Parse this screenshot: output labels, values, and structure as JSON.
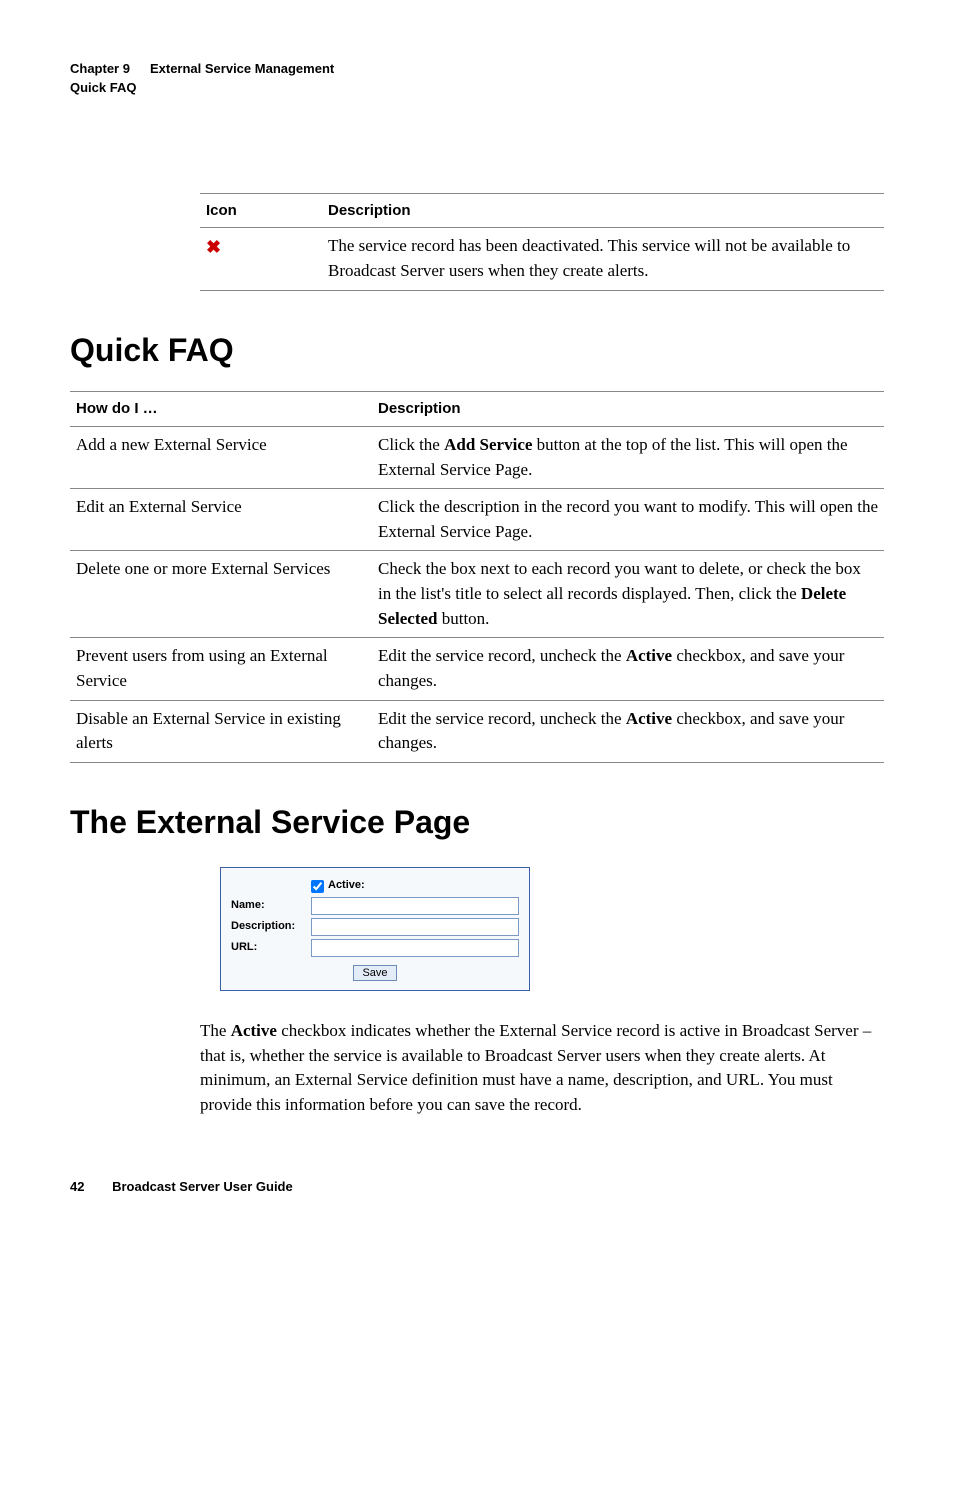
{
  "header": {
    "chapter_label": "Chapter 9",
    "chapter_title": "External Service Management",
    "section_label": "Quick FAQ"
  },
  "icon_table": {
    "head_icon": "Icon",
    "head_desc": "Description",
    "rows": [
      {
        "icon_name": "x-icon",
        "desc": "The service record has been deactivated. This service will not be available to Broadcast Server users when they create alerts."
      }
    ]
  },
  "section1": {
    "title": "Quick FAQ"
  },
  "faq_table": {
    "head_howdo": "How do I …",
    "head_desc": "Description",
    "rows": [
      {
        "howdo": "Add a new External Service",
        "desc_pre": "Click the ",
        "desc_bold": "Add Service",
        "desc_post": " button at the top of the list. This will open the External Service Page."
      },
      {
        "howdo": "Edit an External Service",
        "desc_plain": "Click the description in the record you want to modify. This will open the External Service Page."
      },
      {
        "howdo": "Delete one or more External Services",
        "desc_pre": "Check the box next to each record you want to delete, or check the box in the list's title to select all records displayed. Then, click the ",
        "desc_bold": "Delete Selected",
        "desc_post": " button."
      },
      {
        "howdo": "Prevent users from using an External Service",
        "desc_pre": "Edit the service record, uncheck the ",
        "desc_bold": "Active",
        "desc_post": " checkbox, and save your changes."
      },
      {
        "howdo": "Disable an External Service in existing alerts",
        "desc_pre": "Edit the service record, uncheck the ",
        "desc_bold": "Active",
        "desc_post": " checkbox, and save your changes."
      }
    ]
  },
  "section2": {
    "title": "The External Service Page"
  },
  "form": {
    "active_label": "Active:",
    "name_label": "Name:",
    "desc_label": "Description:",
    "url_label": "URL:",
    "save_label": "Save"
  },
  "body_para": {
    "pre": "The ",
    "bold": "Active",
    "post": " checkbox indicates whether the External Service record is active in Broadcast Server – that is, whether the service is available to Broadcast Server users when they create alerts. At minimum, an External Service definition must have a name, description, and URL. You must provide this information before you can save the record."
  },
  "footer": {
    "page": "42",
    "title": "Broadcast Server User Guide"
  }
}
